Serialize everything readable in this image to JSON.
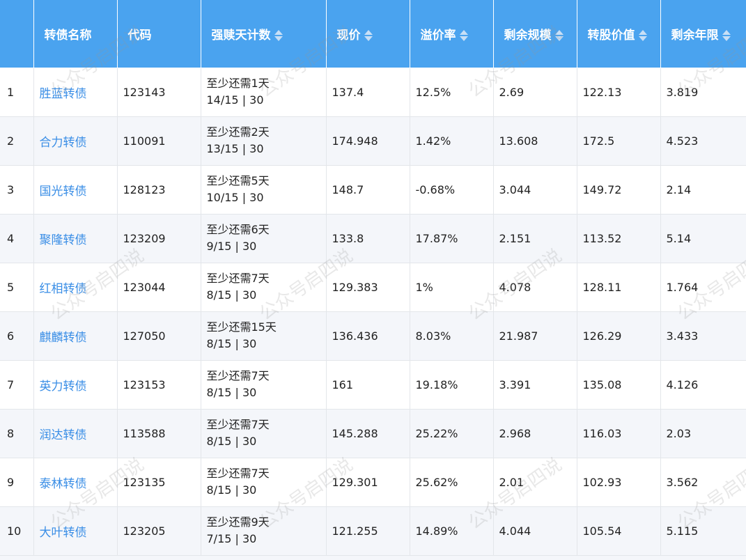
{
  "table": {
    "headers": [
      {
        "label": "",
        "sortable": false
      },
      {
        "label": "转债名称",
        "sortable": false
      },
      {
        "label": "代码",
        "sortable": false
      },
      {
        "label": "强赎天计数",
        "sortable": true
      },
      {
        "label": "现价",
        "sortable": true
      },
      {
        "label": "溢价率",
        "sortable": true
      },
      {
        "label": "剩余规模",
        "sortable": true
      },
      {
        "label": "转股价值",
        "sortable": true
      },
      {
        "label": "剩余年限",
        "sortable": true
      }
    ],
    "rows": [
      {
        "idx": "1",
        "name": "胜蓝转债",
        "code": "123143",
        "redeem_1": "至少还需1天",
        "redeem_2": "14/15 | 30",
        "price": "137.4",
        "premium": "12.5%",
        "scale": "2.69",
        "conv_value": "122.13",
        "years": "3.819"
      },
      {
        "idx": "2",
        "name": "合力转债",
        "code": "110091",
        "redeem_1": "至少还需2天",
        "redeem_2": "13/15 | 30",
        "price": "174.948",
        "premium": "1.42%",
        "scale": "13.608",
        "conv_value": "172.5",
        "years": "4.523"
      },
      {
        "idx": "3",
        "name": "国光转债",
        "code": "128123",
        "redeem_1": "至少还需5天",
        "redeem_2": "10/15 | 30",
        "price": "148.7",
        "premium": "-0.68%",
        "scale": "3.044",
        "conv_value": "149.72",
        "years": "2.14"
      },
      {
        "idx": "4",
        "name": "聚隆转债",
        "code": "123209",
        "redeem_1": "至少还需6天",
        "redeem_2": "9/15 | 30",
        "price": "133.8",
        "premium": "17.87%",
        "scale": "2.151",
        "conv_value": "113.52",
        "years": "5.14"
      },
      {
        "idx": "5",
        "name": "红相转债",
        "code": "123044",
        "redeem_1": "至少还需7天",
        "redeem_2": "8/15 | 30",
        "price": "129.383",
        "premium": "1%",
        "scale": "4.078",
        "conv_value": "128.11",
        "years": "1.764"
      },
      {
        "idx": "6",
        "name": "麒麟转债",
        "code": "127050",
        "redeem_1": "至少还需15天",
        "redeem_2": "8/15 | 30",
        "price": "136.436",
        "premium": "8.03%",
        "scale": "21.987",
        "conv_value": "126.29",
        "years": "3.433"
      },
      {
        "idx": "7",
        "name": "英力转债",
        "code": "123153",
        "redeem_1": "至少还需7天",
        "redeem_2": "8/15 | 30",
        "price": "161",
        "premium": "19.18%",
        "scale": "3.391",
        "conv_value": "135.08",
        "years": "4.126"
      },
      {
        "idx": "8",
        "name": "润达转债",
        "code": "113588",
        "redeem_1": "至少还需7天",
        "redeem_2": "8/15 | 30",
        "price": "145.288",
        "premium": "25.22%",
        "scale": "2.968",
        "conv_value": "116.03",
        "years": "2.03"
      },
      {
        "idx": "9",
        "name": "泰林转债",
        "code": "123135",
        "redeem_1": "至少还需7天",
        "redeem_2": "8/15 | 30",
        "price": "129.301",
        "premium": "25.62%",
        "scale": "2.01",
        "conv_value": "102.93",
        "years": "3.562"
      },
      {
        "idx": "10",
        "name": "大叶转债",
        "code": "123205",
        "redeem_1": "至少还需9天",
        "redeem_2": "7/15 | 30",
        "price": "121.255",
        "premium": "14.89%",
        "scale": "4.044",
        "conv_value": "105.54",
        "years": "5.115"
      }
    ]
  },
  "watermark": "公众号启四说",
  "colors": {
    "header_bg": "#4aa3ef",
    "link": "#3a8ee6",
    "stripe": "#f4f6fa"
  }
}
